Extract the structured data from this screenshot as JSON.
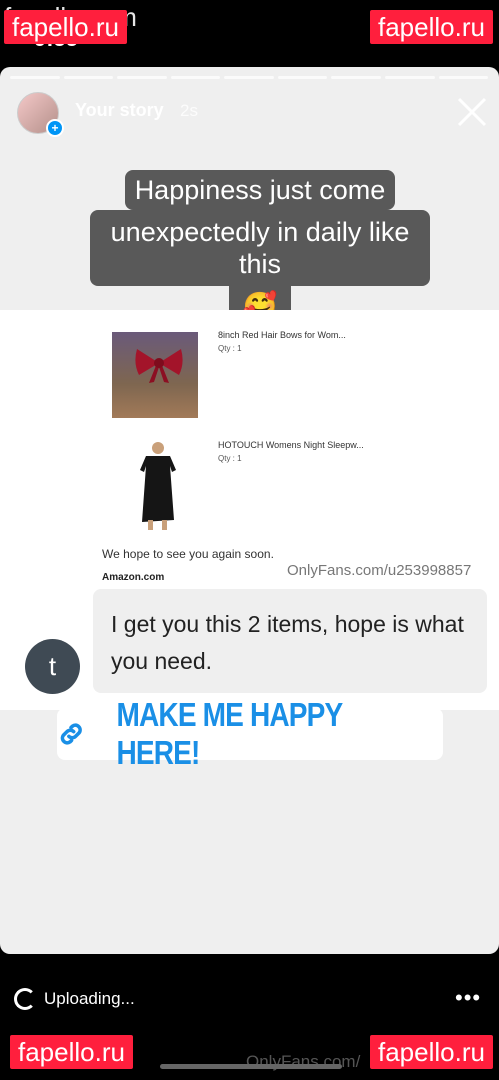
{
  "status_bar": {
    "time": "9:55",
    "icons": "ıll ≋ ▭"
  },
  "watermarks": {
    "top_left": "fapello.ru",
    "top_left_ghost": "fapello.com",
    "top_right": "fapello.ru",
    "bottom_left": "fapello.ru",
    "bottom_right": "fapello.ru"
  },
  "story": {
    "title": "Your story",
    "time": "2s",
    "progress_segments": 9,
    "caption_line1": "Happiness just come",
    "caption_line2": "unexpectedly in daily like this",
    "caption_emoji": "🥰"
  },
  "receipt": {
    "items": [
      {
        "name": "8inch Red Hair Bows for Wom...",
        "qty": "Qty : 1"
      },
      {
        "name": "HOTOUCH Womens Night Sleepw...",
        "qty": "Qty : 1"
      }
    ],
    "hope_text": "We hope to see you again soon.",
    "brand": "Amazon.com",
    "watermark": "OnlyFans.com/u253998857"
  },
  "message": {
    "avatar_letter": "t",
    "text": "I get you this 2 items, hope is what you need."
  },
  "link_sticker": {
    "label": "MAKE ME HAPPY HERE!"
  },
  "bottom": {
    "uploading_label": "Uploading...",
    "more": "•••",
    "watermark": "OnlyFans.com/"
  }
}
